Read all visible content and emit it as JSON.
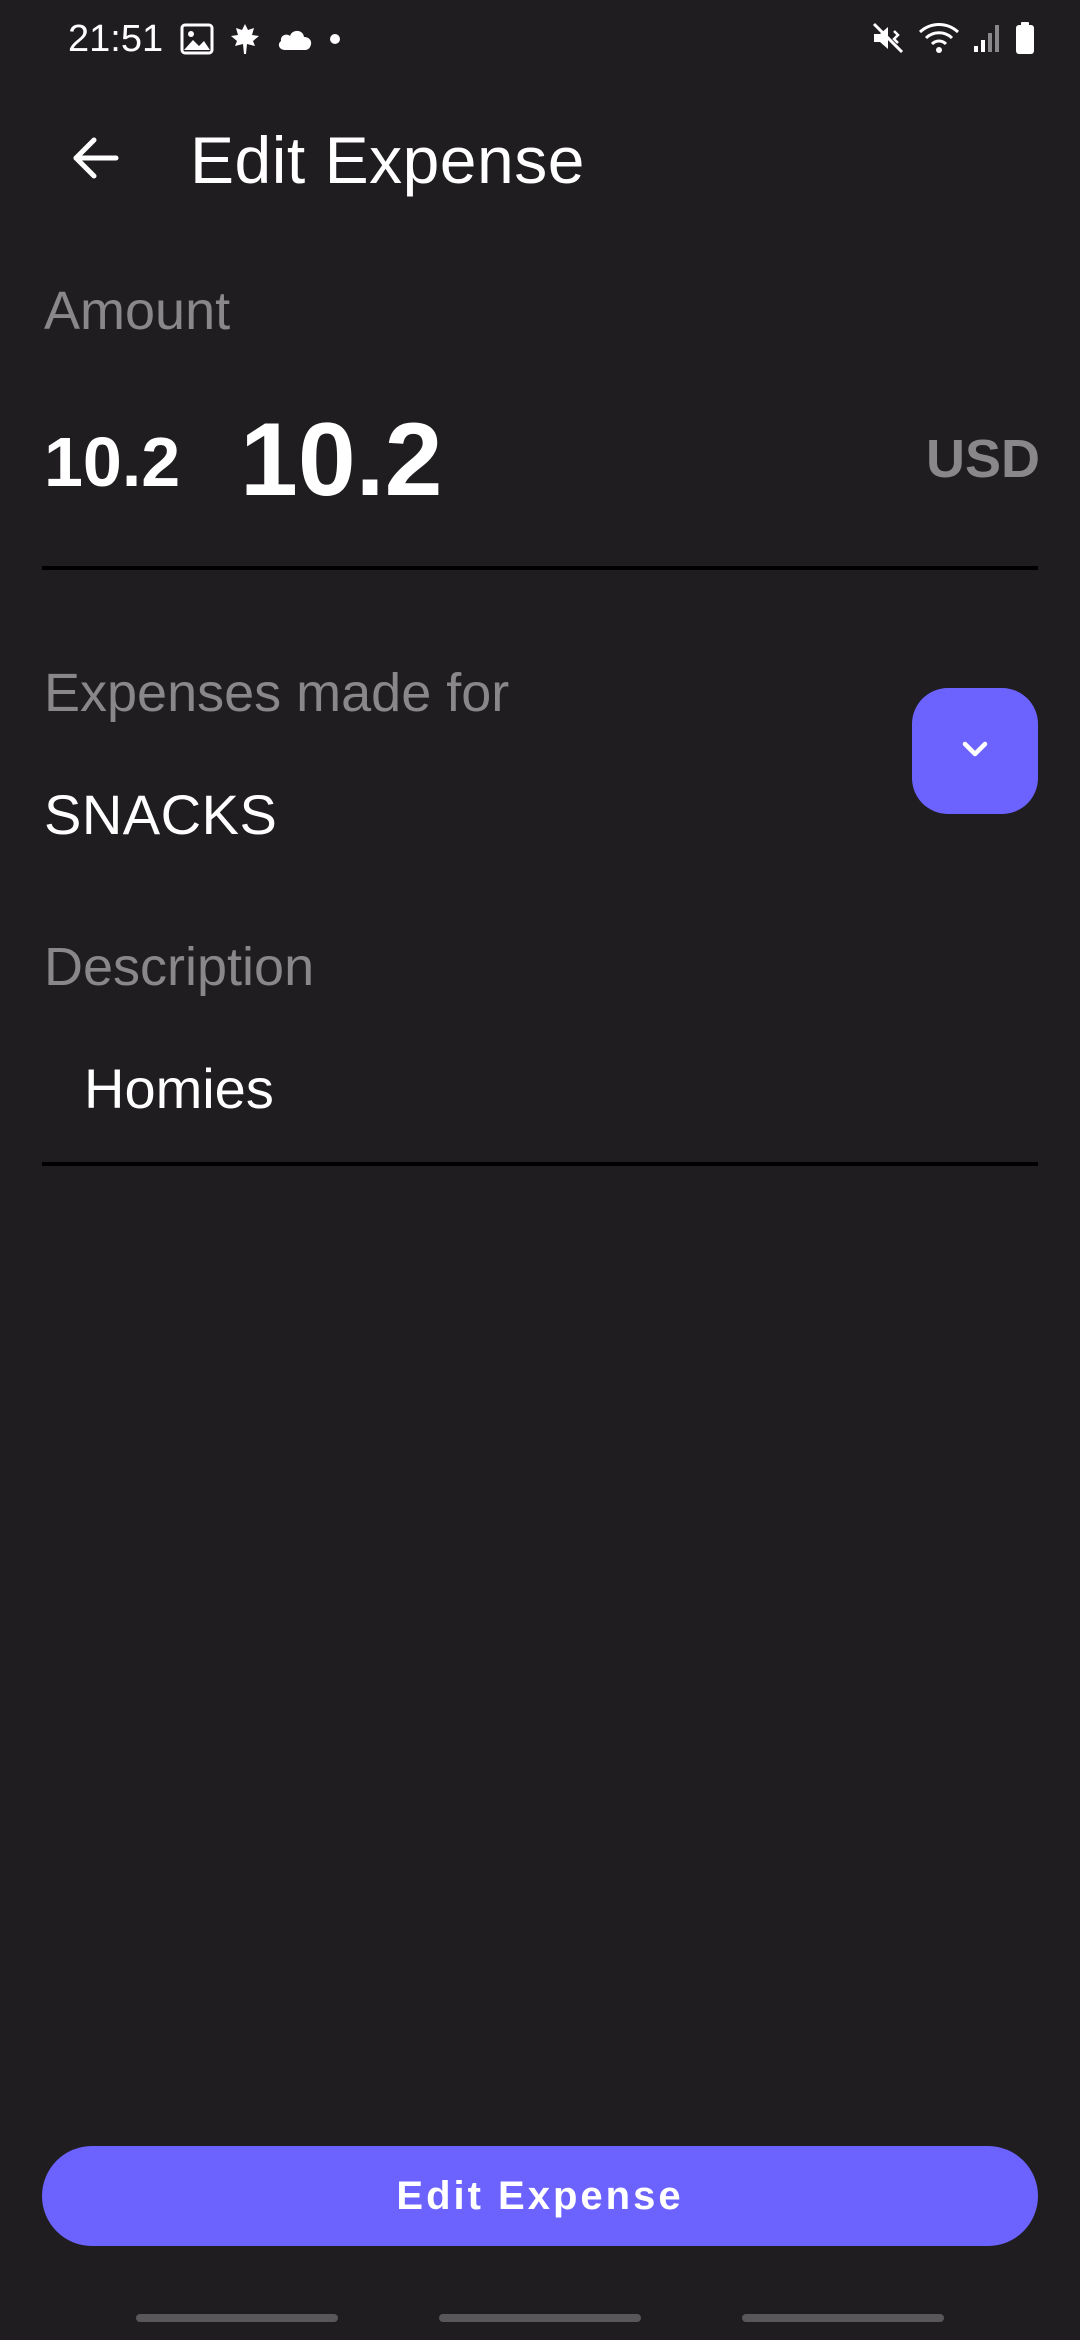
{
  "status_bar": {
    "time": "21:51",
    "left_icons": [
      "gallery-icon",
      "maple-leaf-icon",
      "cloud-icon",
      "dot-icon"
    ],
    "right_icons": [
      "mute-vibrate-icon",
      "wifi-icon",
      "signal-icon",
      "battery-icon"
    ]
  },
  "app_bar": {
    "title": "Edit Expense",
    "back_icon": "arrow-left-icon"
  },
  "amount": {
    "label": "Amount",
    "display_value": "10.2",
    "input_value": "10.2",
    "currency": "USD"
  },
  "category": {
    "label": "Expenses made for",
    "selected_value": "SNACKS",
    "dropdown_icon": "chevron-down-icon"
  },
  "description": {
    "label": "Description",
    "value": "Homies"
  },
  "actions": {
    "submit_label": "Edit Expense"
  },
  "colors": {
    "background": "#201d20",
    "accent": "#6c63ff",
    "muted_text": "#8a878b",
    "text": "#ffffff",
    "divider": "#000000"
  }
}
